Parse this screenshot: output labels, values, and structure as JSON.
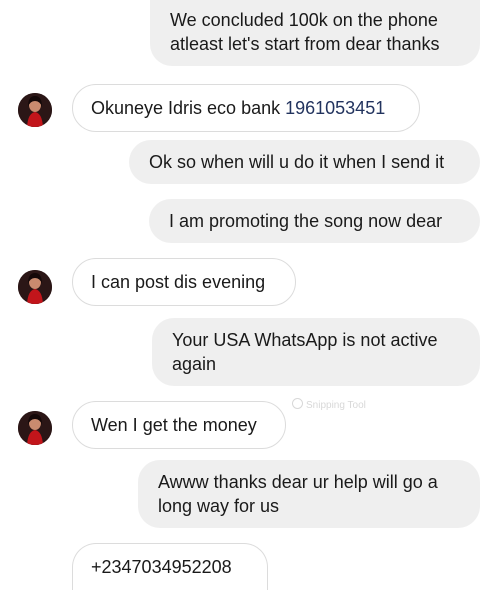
{
  "messages": [
    {
      "type": "outgoing",
      "lines": [
        "We concluded 100k on the phone",
        "atleast let's start from dear thanks"
      ]
    },
    {
      "type": "incoming",
      "text_prefix": "Okuneye Idris eco bank ",
      "account_number": "1961053451"
    },
    {
      "type": "outgoing",
      "lines": [
        "Ok so when will u do it when I send it"
      ]
    },
    {
      "type": "outgoing",
      "lines": [
        "I am promoting the song now dear"
      ]
    },
    {
      "type": "incoming",
      "text": "I can post dis evening"
    },
    {
      "type": "outgoing",
      "lines": [
        "Your USA WhatsApp is not active",
        "again"
      ]
    },
    {
      "type": "incoming",
      "text": "Wen I get the money"
    },
    {
      "type": "outgoing",
      "lines": [
        "Awww thanks dear ur help will go a",
        "long way for us"
      ]
    },
    {
      "type": "incoming",
      "text": "+2347034952208"
    }
  ],
  "watermark": "Snipping Tool",
  "colors": {
    "outgoing_bubble": "#efefef",
    "incoming_border": "#dcdcdc",
    "number_text": "#22335e"
  },
  "icons": {
    "avatar": "profile-photo-avatar"
  }
}
